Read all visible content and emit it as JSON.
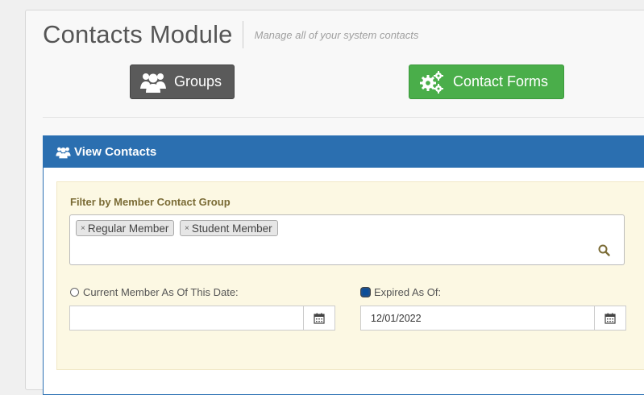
{
  "header": {
    "title": "Contacts Module",
    "subtitle": "Manage all of your system contacts"
  },
  "buttons": {
    "groups_label": "Groups",
    "contact_forms_label": "Contact Forms"
  },
  "panel": {
    "title": "View Contacts"
  },
  "filter": {
    "label": "Filter by Member Contact Group",
    "tags": [
      "Regular Member",
      "Student Member"
    ],
    "remove_glyph": "×"
  },
  "current_member": {
    "label": "Current Member As Of This Date:",
    "value": "",
    "checked": false
  },
  "expired": {
    "label": "Expired As Of:",
    "value": "12/01/2022",
    "checked": true
  },
  "icons": {
    "groups": "users-icon",
    "forms": "gears-icon",
    "panel": "users-icon",
    "search": "search-icon",
    "calendar": "calendar-icon"
  },
  "colors": {
    "groups_button": "#5a5a5a",
    "forms_button": "#4aae4a",
    "panel_header": "#2b6fb0",
    "filter_bg": "#fcf8e3"
  }
}
